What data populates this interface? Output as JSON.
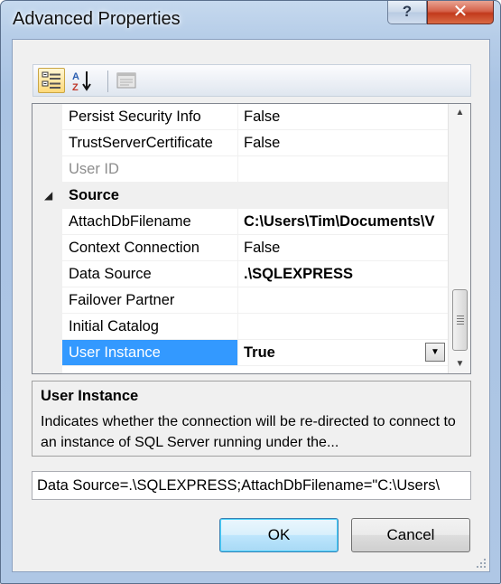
{
  "window": {
    "title": "Advanced Properties",
    "help_label": "?",
    "close_label": "✕"
  },
  "toolbar": {
    "buttons": [
      {
        "name": "categorized-icon",
        "active": true
      },
      {
        "name": "sort-alphabetical-icon",
        "active": false
      },
      {
        "name": "property-pages-icon",
        "active": false
      }
    ]
  },
  "grid": {
    "rows": [
      {
        "name": "Persist Security Info",
        "value": "False",
        "bold": false
      },
      {
        "name": "TrustServerCertificate",
        "value": "False",
        "bold": false
      },
      {
        "name": "User ID",
        "value": "",
        "disabled": true
      },
      {
        "category": true,
        "label": "Source"
      },
      {
        "name": "AttachDbFilename",
        "value": "C:\\Users\\Tim\\Documents\\V",
        "bold": true
      },
      {
        "name": "Context Connection",
        "value": "False",
        "bold": false
      },
      {
        "name": "Data Source",
        "value": ".\\SQLEXPRESS",
        "bold": true
      },
      {
        "name": "Failover Partner",
        "value": "",
        "bold": false
      },
      {
        "name": "Initial Catalog",
        "value": "",
        "bold": false
      },
      {
        "name": "User Instance",
        "value": "True",
        "bold": true,
        "selected": true,
        "dropdown": true
      }
    ]
  },
  "description": {
    "title": "User Instance",
    "text": "Indicates whether the connection will be re-directed to connect to an instance of SQL Server running under the..."
  },
  "connection_string": "Data Source=.\\SQLEXPRESS;AttachDbFilename=\"C:\\Users\\",
  "buttons": {
    "ok_label": "OK",
    "cancel_label": "Cancel"
  },
  "colors": {
    "selection": "#3399ff",
    "title_bar": "#b6cde8",
    "close_button": "#c23a1c"
  }
}
